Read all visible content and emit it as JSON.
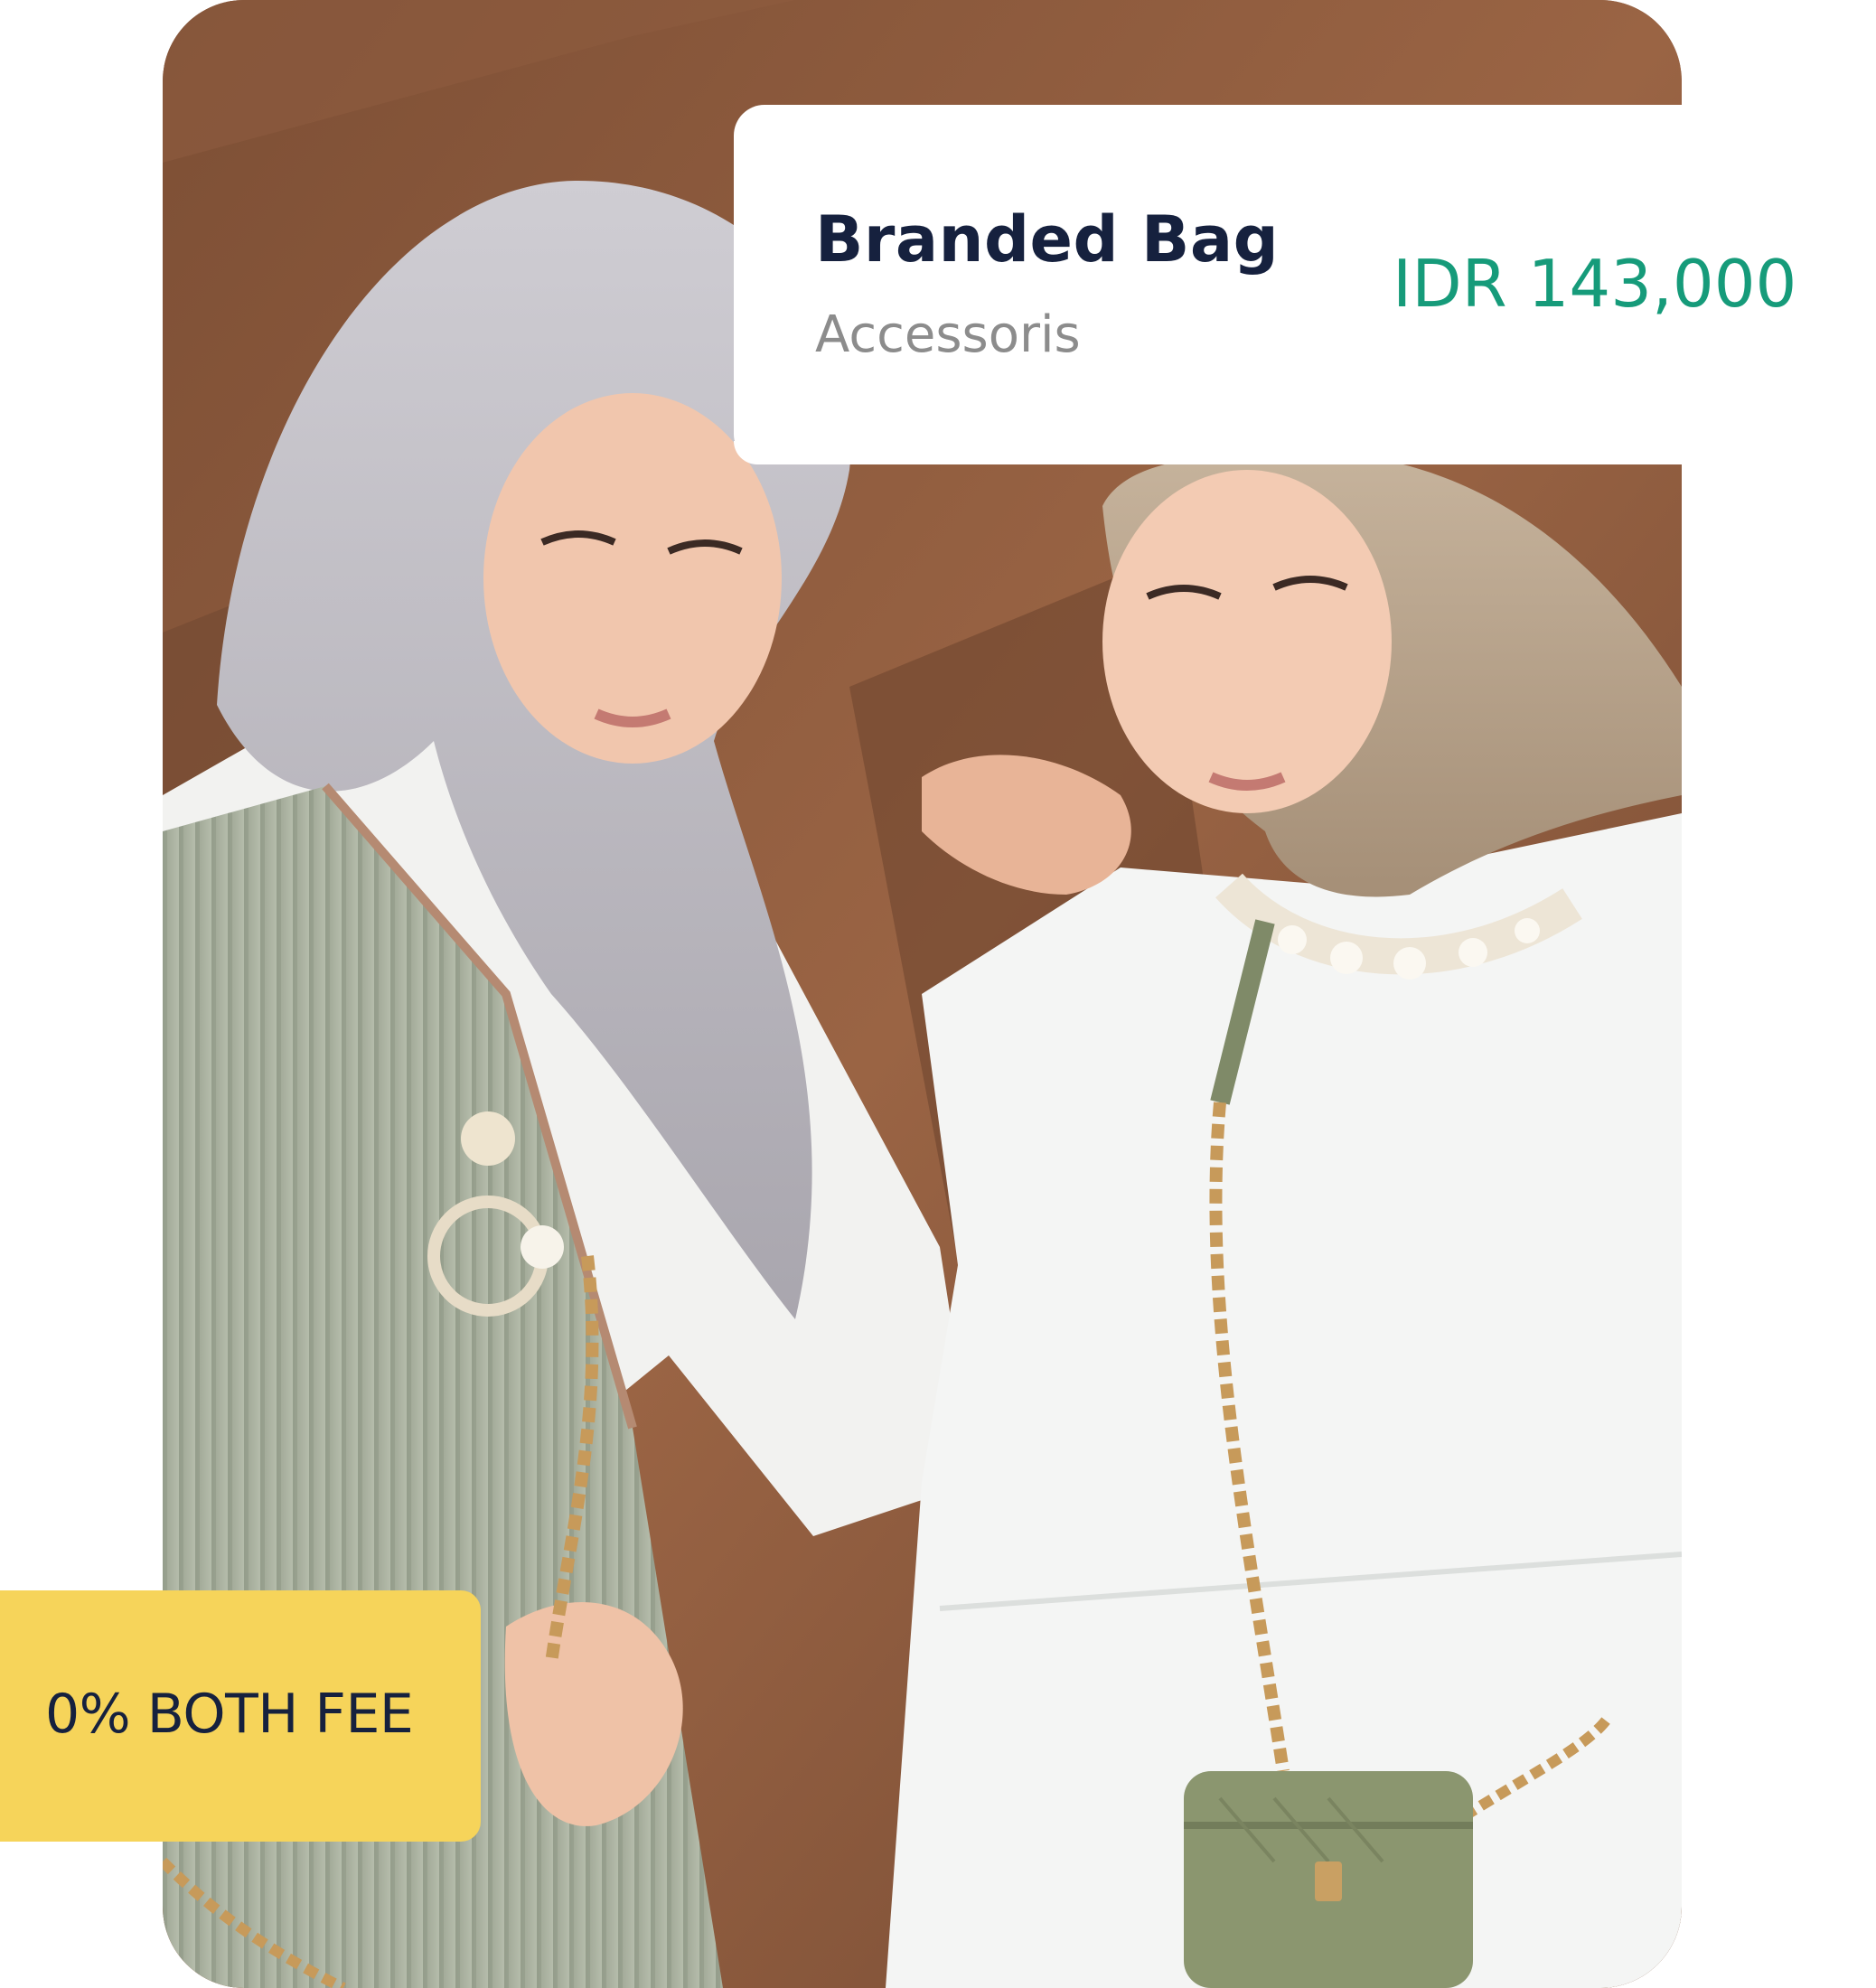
{
  "product": {
    "name": "Branded Bag",
    "category": "Accessoris",
    "price": "IDR 143,000"
  },
  "badge": {
    "label": "0% BOTH FEE"
  },
  "colors": {
    "price_accent": "#169b7a",
    "badge_background": "#f6d45a",
    "title_text": "#16213e",
    "category_text": "#8c8c8c"
  }
}
